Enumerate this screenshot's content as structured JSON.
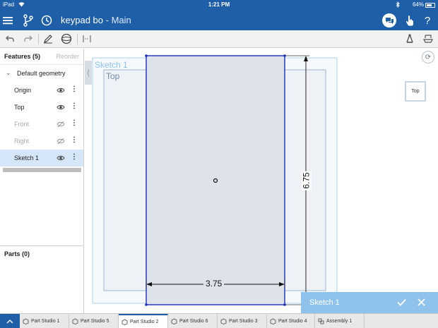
{
  "status": {
    "device": "iPad",
    "time": "1:21 PM",
    "battery": "64%"
  },
  "header": {
    "doc_name": "keypad bo",
    "separator": " - ",
    "branch": "Main"
  },
  "features": {
    "title": "Features (5)",
    "reorder": "Reorder",
    "items": [
      {
        "label": "Default geometry",
        "type": "group"
      },
      {
        "label": "Origin",
        "visible": true
      },
      {
        "label": "Top",
        "visible": true
      },
      {
        "label": "Front",
        "visible": false
      },
      {
        "label": "Right",
        "visible": false
      },
      {
        "label": "Sketch 1",
        "visible": true,
        "selected": true
      }
    ]
  },
  "parts": {
    "title": "Parts (0)"
  },
  "viewport": {
    "sketch_label": "Sketch 1",
    "plane_label": "Top",
    "dim_vertical": "6.75",
    "dim_horizontal": "3.75",
    "viewcube_label": "Top"
  },
  "sketchbar": {
    "title": "Sketch 1"
  },
  "tabs": [
    {
      "label": "Part Studio 1",
      "active": false
    },
    {
      "label": "Part Studio 5",
      "active": false
    },
    {
      "label": "Part Studio 2",
      "active": true
    },
    {
      "label": "Part Studio 6",
      "active": false
    },
    {
      "label": "Part Studio 3",
      "active": false
    },
    {
      "label": "Part Studio 4",
      "active": false
    },
    {
      "label": "Assembly 1",
      "active": false
    }
  ],
  "colors": {
    "brand_blue": "#1f5fa8",
    "sketch_blue": "#1b2fbf",
    "selection": "#d4e6f8",
    "confirm_bar": "#8fc3ec"
  }
}
